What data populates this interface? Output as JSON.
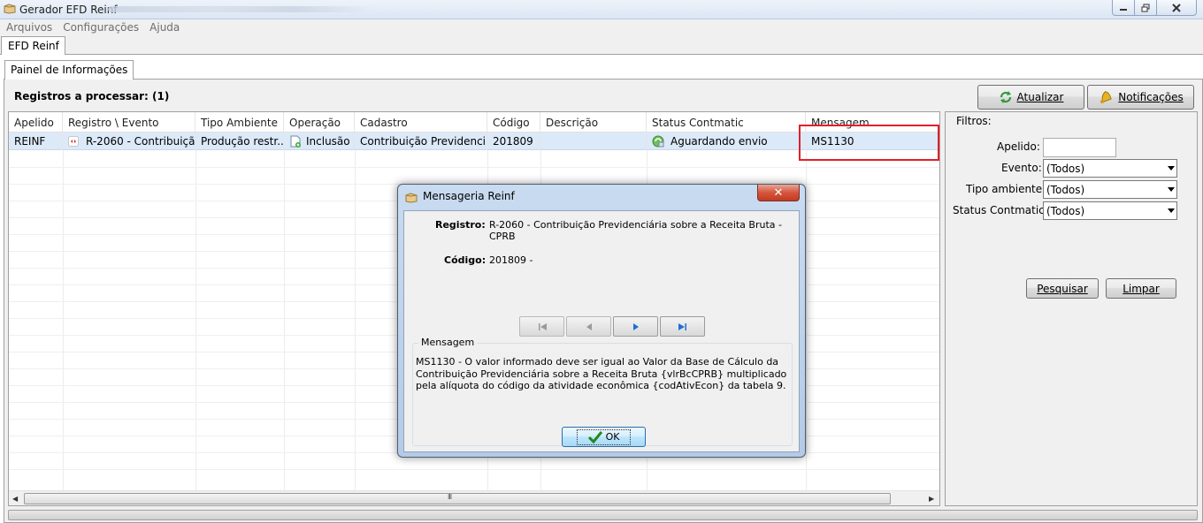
{
  "window": {
    "title": "Gerador EFD Reinf",
    "controls": {
      "minimize": "minimize-icon",
      "maximize": "restore-icon",
      "close": "close-icon"
    }
  },
  "menu": [
    "Arquivos",
    "Configurações",
    "Ajuda"
  ],
  "tabs": {
    "outer": "EFD Reinf",
    "inner": "Painel de Informações"
  },
  "registros_label": "Registros a processar: (1)",
  "toolbar": {
    "atualizar": "Atualizar",
    "notificacoes": "Notificações"
  },
  "grid": {
    "columns": [
      "Apelido",
      "Registro \\ Evento",
      "Tipo Ambiente",
      "Operação",
      "Cadastro",
      "Código",
      "Descrição",
      "Status Contmatic",
      "Mensagem"
    ],
    "rows": [
      {
        "apelido": "REINF",
        "registro": "R-2060 - Contribuiçã...",
        "tipo_ambiente": "Produção restr...",
        "operacao": "Inclusão",
        "cadastro": "Contribuição Previdenci...",
        "codigo": "201809",
        "descricao": "",
        "status": "Aguardando envio",
        "mensagem": "MS1130"
      }
    ],
    "scroll_grip": "III"
  },
  "filtros": {
    "legend": "Filtros:",
    "apelido_label": "Apelido:",
    "apelido_value": "",
    "evento_label": "Evento:",
    "evento_value": "(Todos)",
    "tipo_label": "Tipo ambiente:",
    "tipo_value": "(Todos)",
    "status_label": "Status Contmatic:",
    "status_value": "(Todos)",
    "pesquisar": "Pesquisar",
    "limpar": "Limpar"
  },
  "dialog": {
    "title": "Mensageria Reinf",
    "close": "✕",
    "registro_label": "Registro:",
    "registro_value": "R-2060 - Contribuição Previdenciária sobre a Receita Bruta - CPRB",
    "codigo_label": "Código:",
    "codigo_value": "201809 -",
    "mensagem_legend": "Mensagem",
    "mensagem_text": "MS1130 - O valor informado deve ser igual ao Valor da Base de Cálculo da Contribuição Previdenciária sobre a Receita Bruta {vlrBcCPRB} multiplicado pela alíquota do código da atividade econômica {codAtivEcon} da tabela 9.",
    "ok": "OK"
  },
  "colors": {
    "highlight_row": "#dce9f8",
    "red_box": "#e0202a",
    "accent_blue": "#1f6fd8"
  }
}
